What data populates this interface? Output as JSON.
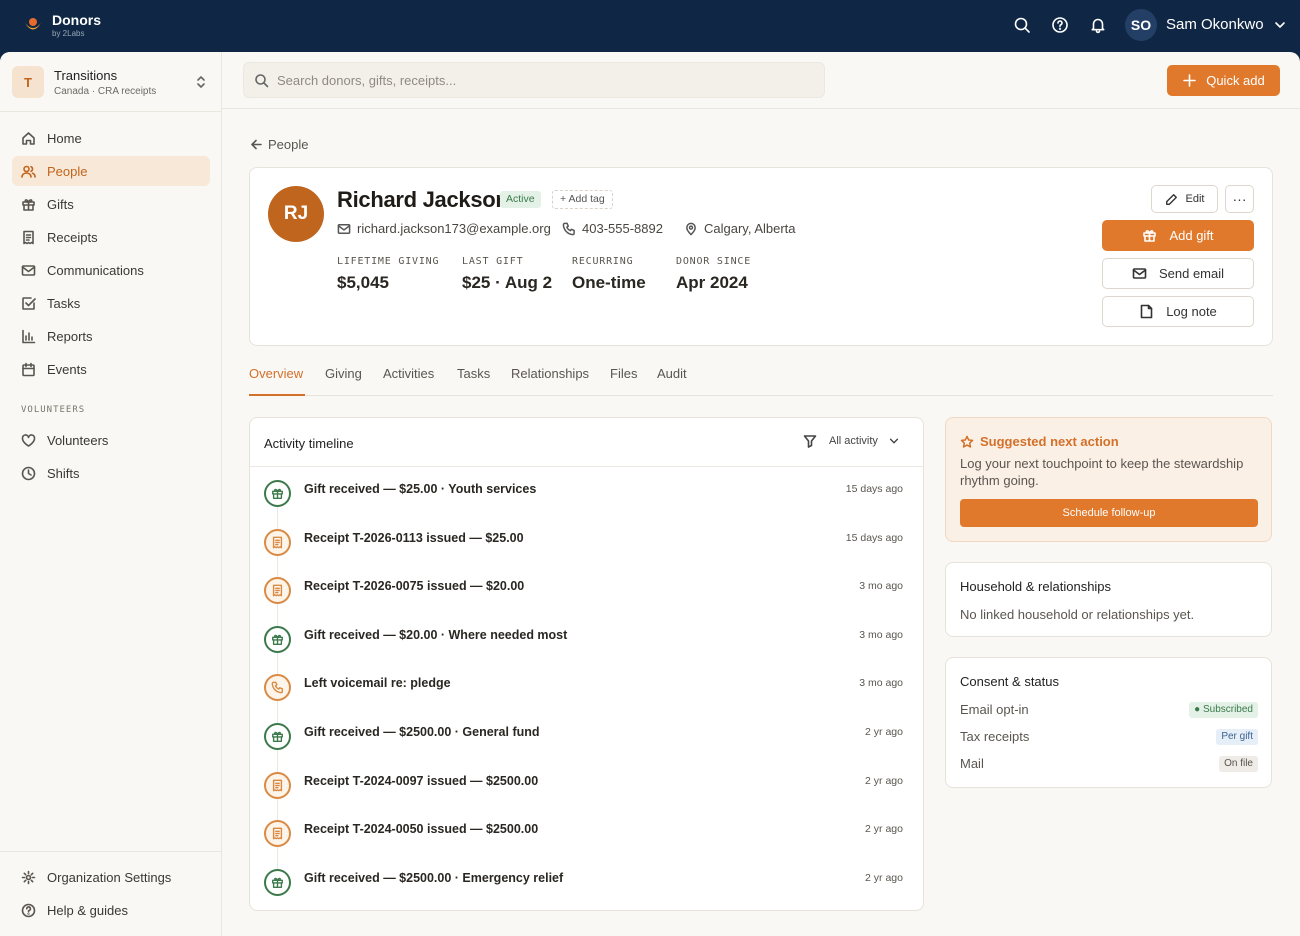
{
  "brand": {
    "name": "Donors",
    "sub": "by 2Labs"
  },
  "user": {
    "initials": "SO",
    "name": "Sam Okonkwo"
  },
  "org": {
    "badge": "T",
    "name": "Transitions",
    "sub": "Canada · CRA receipts"
  },
  "nav": [
    {
      "label": "Home",
      "icon": "home-icon"
    },
    {
      "label": "People",
      "icon": "users-icon",
      "active": true
    },
    {
      "label": "Gifts",
      "icon": "gift-icon"
    },
    {
      "label": "Receipts",
      "icon": "receipt-icon"
    },
    {
      "label": "Communications",
      "icon": "mail-icon"
    },
    {
      "label": "Tasks",
      "icon": "check-square-icon"
    },
    {
      "label": "Reports",
      "icon": "bar-chart-icon"
    },
    {
      "label": "Events",
      "icon": "calendar-icon"
    }
  ],
  "volunteers": {
    "heading": "VOLUNTEERS",
    "items": [
      {
        "label": "Volunteers",
        "icon": "heart-icon"
      },
      {
        "label": "Shifts",
        "icon": "clock-icon"
      }
    ]
  },
  "footer_nav": [
    {
      "label": "Organization Settings",
      "icon": "gear-icon"
    },
    {
      "label": "Help & guides",
      "icon": "help-icon"
    }
  ],
  "search": {
    "placeholder": "Search donors, gifts, receipts..."
  },
  "quick_add": "Quick add",
  "back": "People",
  "profile": {
    "initials": "RJ",
    "name": "Richard Jackson",
    "status": "Active",
    "add_tag": "Add tag",
    "email": "richard.jackson173@example.org",
    "phone": "403-555-8892",
    "location": "Calgary, Alberta",
    "stats": [
      {
        "label": "LIFETIME GIVING",
        "value": "$5,045"
      },
      {
        "label": "LAST GIFT",
        "value": "$25 · Aug 2"
      },
      {
        "label": "RECURRING",
        "value": "One-time"
      },
      {
        "label": "DONOR SINCE",
        "value": "Apr 2024"
      }
    ],
    "edit": "Edit",
    "more": "···",
    "add_gift": "Add gift",
    "send_email": "Send email",
    "log_note": "Log note"
  },
  "tabs": [
    "Overview",
    "Giving",
    "Activities",
    "Tasks",
    "Relationships",
    "Files",
    "Audit"
  ],
  "timeline": {
    "title": "Activity timeline",
    "filter": "All activity",
    "items": [
      {
        "type": "gift",
        "text": "Gift received — $25.00 · Youth services",
        "time": "15 days ago"
      },
      {
        "type": "receipt",
        "text": "Receipt T-2026-0113 issued — $25.00",
        "time": "15 days ago"
      },
      {
        "type": "receipt",
        "text": "Receipt T-2026-0075 issued — $20.00",
        "time": "3 mo ago"
      },
      {
        "type": "gift",
        "text": "Gift received — $20.00 · Where needed most",
        "time": "3 mo ago"
      },
      {
        "type": "call",
        "text": "Left voicemail re: pledge",
        "time": "3 mo ago"
      },
      {
        "type": "gift",
        "text": "Gift received — $2500.00 · General fund",
        "time": "2 yr ago"
      },
      {
        "type": "receipt",
        "text": "Receipt T-2024-0097 issued — $2500.00",
        "time": "2 yr ago"
      },
      {
        "type": "receipt",
        "text": "Receipt T-2024-0050 issued — $2500.00",
        "time": "2 yr ago"
      },
      {
        "type": "gift",
        "text": "Gift received — $2500.00 · Emergency relief",
        "time": "2 yr ago"
      }
    ]
  },
  "next_action": {
    "title": "Suggested next action",
    "desc": "Log your next touchpoint to keep the stewardship rhythm going.",
    "button": "Schedule follow-up"
  },
  "household": {
    "title": "Household & relationships",
    "desc": "No linked household or relationships yet."
  },
  "consent": {
    "title": "Consent & status",
    "rows": [
      {
        "label": "Email opt-in",
        "badge": "● Subscribed",
        "kind": "sub"
      },
      {
        "label": "Tax receipts",
        "badge": "Per gift",
        "kind": "per"
      },
      {
        "label": "Mail",
        "badge": "On file",
        "kind": "file"
      }
    ]
  },
  "colors": {
    "accent": "#e0792c",
    "navy": "#0f2744",
    "success": "#3c7a4c"
  }
}
